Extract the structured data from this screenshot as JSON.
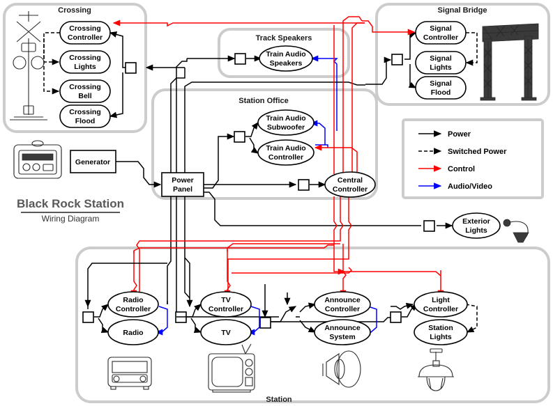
{
  "title": {
    "main": "Black Rock Station",
    "sub": "Wiring Diagram"
  },
  "groups": {
    "crossing": "Crossing",
    "track_speakers": "Track Speakers",
    "signal_bridge": "Signal Bridge",
    "station_office": "Station Office",
    "station": "Station"
  },
  "nodes": {
    "crossing_controller": "Crossing\nController",
    "crossing_controller_l1": "Crossing",
    "crossing_controller_l2": "Controller",
    "crossing_lights_l1": "Crossing",
    "crossing_lights_l2": "Lights",
    "crossing_bell_l1": "Crossing",
    "crossing_bell_l2": "Bell",
    "crossing_flood_l1": "Crossing",
    "crossing_flood_l2": "Flood",
    "train_audio_speakers_l1": "Train Audio",
    "train_audio_speakers_l2": "Speakers",
    "signal_controller_l1": "Signal",
    "signal_controller_l2": "Controller",
    "signal_lights_l1": "Signal",
    "signal_lights_l2": "Lights",
    "signal_flood_l1": "Signal",
    "signal_flood_l2": "Flood",
    "generator": "Generator",
    "train_audio_subwoofer_l1": "Train Audio",
    "train_audio_subwoofer_l2": "Subwoofer",
    "train_audio_controller_l1": "Train Audio",
    "train_audio_controller_l2": "Controller",
    "power_panel_l1": "Power",
    "power_panel_l2": "Panel",
    "central_controller_l1": "Central",
    "central_controller_l2": "Controller",
    "exterior_lights_l1": "Exterior",
    "exterior_lights_l2": "Lights",
    "radio_controller_l1": "Radio",
    "radio_controller_l2": "Controller",
    "radio": "Radio",
    "tv_controller_l1": "TV",
    "tv_controller_l2": "Controller",
    "tv": "TV",
    "announce_controller_l1": "Announce",
    "announce_controller_l2": "Controller",
    "announce_system_l1": "Announce",
    "announce_system_l2": "System",
    "light_controller_l1": "Light",
    "light_controller_l2": "Controller",
    "station_lights_l1": "Station",
    "station_lights_l2": "Lights"
  },
  "legend": {
    "items": [
      {
        "label": "Power",
        "color": "#000000",
        "style": "solid"
      },
      {
        "label": "Switched Power",
        "color": "#000000",
        "style": "dashed"
      },
      {
        "label": "Control",
        "color": "#ff0000",
        "style": "solid"
      },
      {
        "label": "Audio/Video",
        "color": "#0000ff",
        "style": "solid"
      }
    ]
  },
  "colors": {
    "power": "#000000",
    "switched_power": "#000000",
    "control": "#ff0000",
    "audio_video": "#0000ff",
    "group_border": "#cccccc",
    "background": "#ffffff",
    "title": "#595959"
  }
}
